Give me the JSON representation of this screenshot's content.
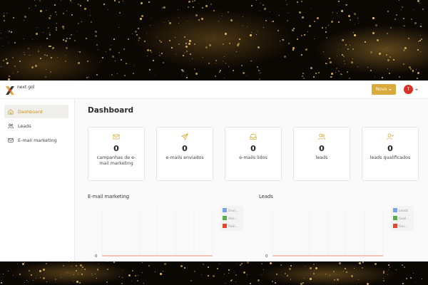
{
  "app": {
    "logo_text": "next gol",
    "new_button_label": "Novo",
    "avatar_initial": "T"
  },
  "sidebar": {
    "items": [
      {
        "label": "Dashboard",
        "icon": "home-icon",
        "active": true
      },
      {
        "label": "Leads",
        "icon": "users-icon",
        "active": false
      },
      {
        "label": "E-mail marketing",
        "icon": "mail-icon",
        "active": false
      }
    ]
  },
  "page": {
    "title": "Dashboard"
  },
  "cards": [
    {
      "value": "0",
      "label": "campanhas de e-mail marketing",
      "icon": "mail-icon"
    },
    {
      "value": "0",
      "label": "e-mails enviados",
      "icon": "send-icon"
    },
    {
      "value": "0",
      "label": "e-mails lidos",
      "icon": "inbox-icon"
    },
    {
      "value": "0",
      "label": "leads",
      "icon": "users-icon"
    },
    {
      "value": "0",
      "label": "leads qualificados",
      "icon": "user-check-icon"
    }
  ],
  "charts": [
    {
      "title": "E-mail marketing",
      "y_tick": "0",
      "legend": [
        {
          "label": "Envi...",
          "color": "#7aa4da"
        },
        {
          "label": "Abe...",
          "color": "#59ad4e"
        },
        {
          "label": "Publ...",
          "color": "#e0472f"
        }
      ]
    },
    {
      "title": "Leads",
      "y_tick": "0",
      "legend": [
        {
          "label": "Leads",
          "color": "#7aa4da"
        },
        {
          "label": "Qual...",
          "color": "#59ad4e"
        },
        {
          "label": "Des...",
          "color": "#e0472f"
        }
      ]
    }
  ],
  "colors": {
    "accent": "#d9ab3c",
    "avatar": "#d93025",
    "zero_line": "#f0a795"
  }
}
